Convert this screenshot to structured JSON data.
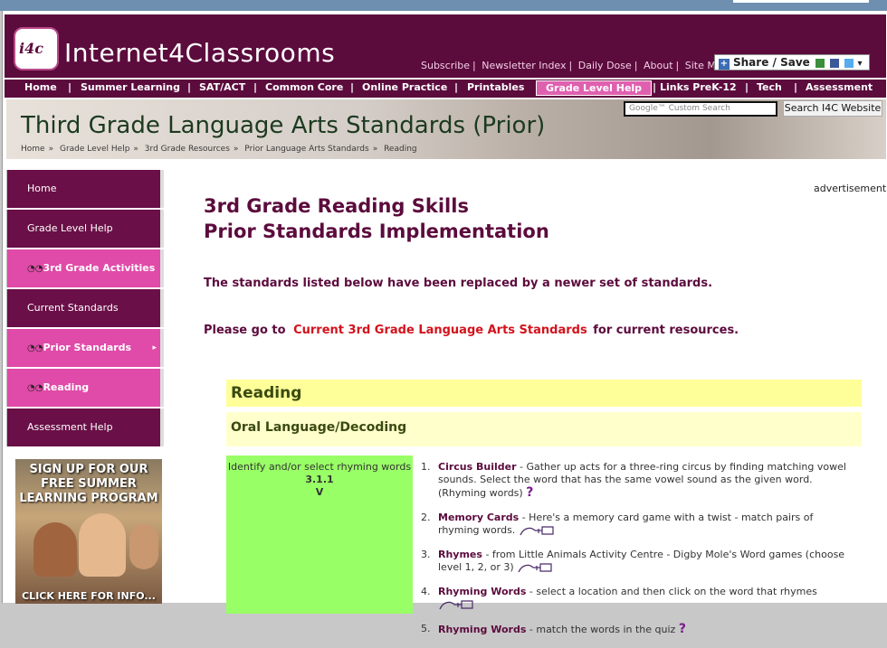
{
  "site": {
    "logo_icon_text": "i4c",
    "logo_text": "Internet4Classrooms"
  },
  "toplinks": [
    "Subscribe",
    "Newsletter Index",
    "Daily Dose",
    "About",
    "Site Map"
  ],
  "share": {
    "label": "Share / Save"
  },
  "nav": [
    {
      "label": "Home",
      "active": false
    },
    {
      "label": "Summer Learning",
      "active": false
    },
    {
      "label": "SAT/ACT",
      "active": false
    },
    {
      "label": "Common Core",
      "active": false
    },
    {
      "label": "Online Practice",
      "active": false
    },
    {
      "label": "Printables",
      "active": false
    },
    {
      "label": "Grade Level Help",
      "active": true
    },
    {
      "label": "Links PreK-12",
      "active": false
    },
    {
      "label": "Tech",
      "active": false
    },
    {
      "label": "Assessment",
      "active": false
    }
  ],
  "banner": {
    "title": "Third Grade Language Arts Standards (Prior)",
    "search_placeholder": "Google™ Custom Search",
    "search_button": "Search I4C Website",
    "breadcrumbs": [
      "Home",
      "Grade Level Help",
      "3rd Grade Resources",
      "Prior Language Arts Standards",
      "Reading"
    ]
  },
  "sidebar": [
    {
      "label": "Home",
      "highlight": false
    },
    {
      "label": "Grade Level Help",
      "highlight": false
    },
    {
      "label": "3rd Grade Activities",
      "highlight": true
    },
    {
      "label": "Current Standards",
      "highlight": false
    },
    {
      "label": "Prior Standards",
      "highlight": true
    },
    {
      "label": "Reading",
      "highlight": true
    },
    {
      "label": "Assessment Help",
      "highlight": false
    }
  ],
  "promo": {
    "headline": "SIGN UP FOR OUR FREE SUMMER LEARNING PROGRAM",
    "cta": "CLICK HERE FOR INFO..."
  },
  "ad_label": "advertisement",
  "main": {
    "title_line1": "3rd Grade Reading Skills",
    "title_line2": "Prior Standards Implementation",
    "notice": "The standards listed below have been replaced by a newer set of standards.",
    "goto_prefix": "Please go to",
    "goto_link": "Current 3rd Grade Language Arts Standards",
    "goto_suffix": "for current resources.",
    "section": "Reading",
    "subsection": "Oral Language/Decoding",
    "standard": {
      "desc": "Identify and/or select rhyming words",
      "code": "3.1.1",
      "level": "V"
    },
    "activities": [
      {
        "num": "1.",
        "name": "Circus Builder",
        "desc": " - Gather up acts for a three-ring circus by finding matching vowel sounds. Select the word that has the same vowel sound as the given word. (Rhyming words)"
      },
      {
        "num": "2.",
        "name": "Memory Cards",
        "desc": " - Here's a memory card game with a twist - match pairs of rhyming words."
      },
      {
        "num": "3.",
        "name": "Rhymes",
        "desc": " - from Little Animals Activity Centre - Digby Mole's Word games (choose level 1, 2, or 3)"
      },
      {
        "num": "4.",
        "name": "Rhyming Words",
        "desc": " - select a location and then click on the word that rhymes"
      },
      {
        "num": "5.",
        "name": "Rhyming Words",
        "desc": " - match the words in the quiz"
      }
    ]
  }
}
